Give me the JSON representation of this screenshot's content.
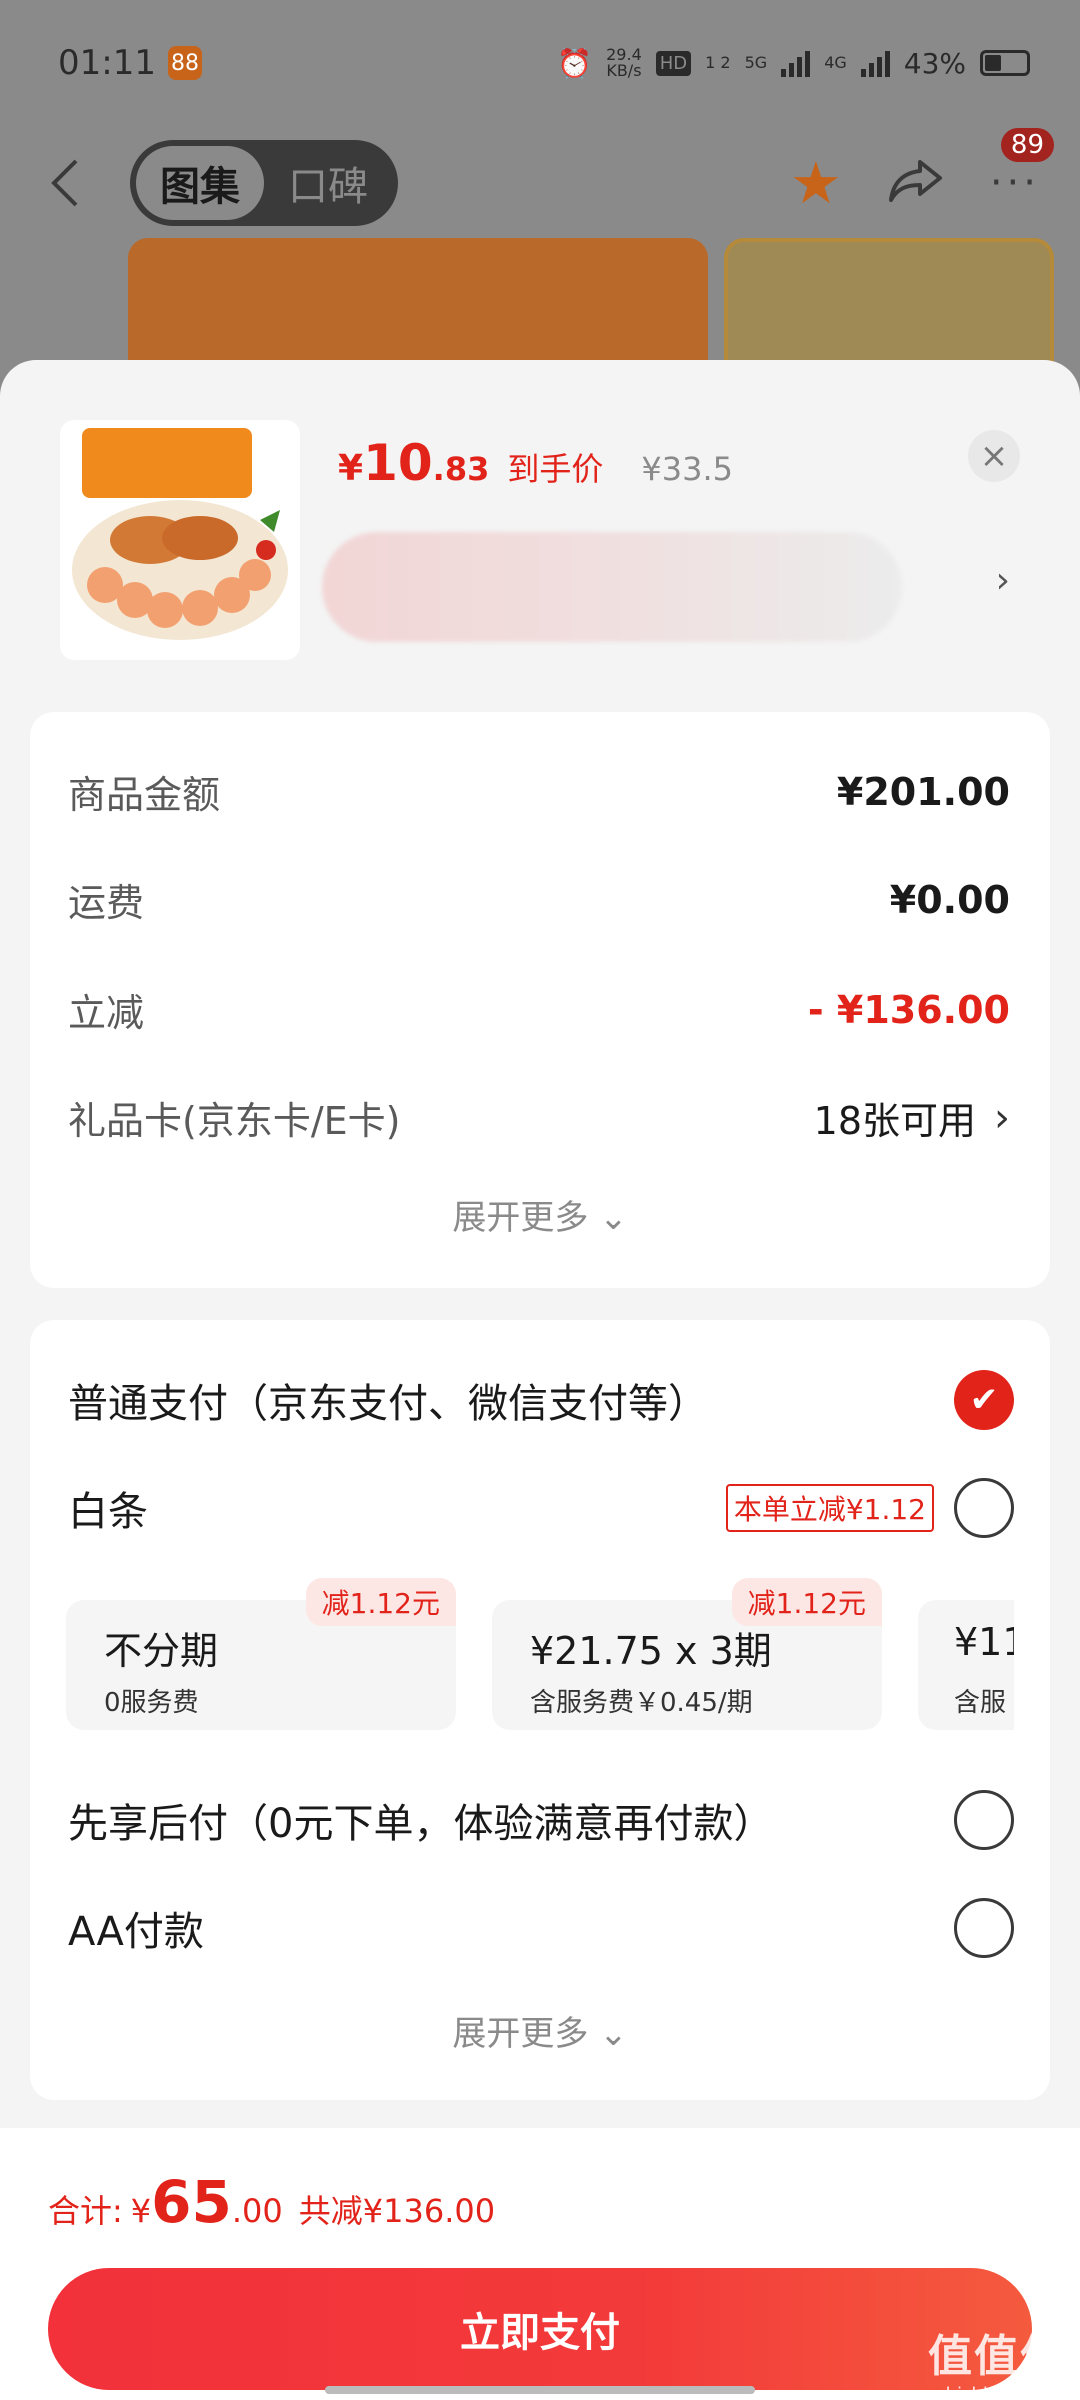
{
  "status_bar": {
    "time": "01:11",
    "app_badge": "88",
    "net_speed_top": "29.4",
    "net_speed_unit": "KB/s",
    "hd": "HD",
    "hd_sub": "1 2",
    "net_5g": "5G",
    "net_4g": "4G",
    "battery": "43%"
  },
  "nav": {
    "tab_gallery": "图集",
    "tab_reviews": "口碑",
    "more_badge": "89"
  },
  "product": {
    "price_symbol": "¥",
    "price_int": "10",
    "price_dec": ".83",
    "price_tag": "到手价",
    "original_price": "¥33.5",
    "close": "×",
    "spec_arrow": "›"
  },
  "summary": {
    "goods_label": "商品金额",
    "goods_value": "¥201.00",
    "shipping_label": "运费",
    "shipping_value": "¥0.00",
    "discount_label": "立减",
    "discount_value": "- ¥136.00",
    "giftcard_label": "礼品卡(京东卡/E卡)",
    "giftcard_value": "18张可用",
    "expand": "展开更多 ⌄"
  },
  "payment": {
    "normal_label": "普通支付（京东支付、微信支付等）",
    "baitiao_label": "白条",
    "baitiao_tag": "本单立减¥1.12",
    "plans": [
      {
        "discount": "减1.12元",
        "title": "不分期",
        "sub": "0服务费"
      },
      {
        "discount": "减1.12元",
        "title": "¥21.75 x 3期",
        "sub": "含服务费￥0.45/期"
      },
      {
        "discount": "",
        "title": "¥11",
        "sub": "含服"
      }
    ],
    "later_label": "先享后付（0元下单，体验满意再付款）",
    "aa_label": "AA付款",
    "expand": "展开更多 ⌄"
  },
  "footer": {
    "total_label": "合计:",
    "total_symbol": "¥",
    "total_int": "65",
    "total_dec": ".00",
    "total_save": "共减¥136.00",
    "pay_button": "立即支付"
  },
  "watermark": {
    "main": "值值值",
    "sub": "zhizhizhi.com"
  },
  "colors": {
    "accent_red": "#e2231a",
    "sheet_bg": "#f4f4f4",
    "card_bg": "#ffffff"
  }
}
